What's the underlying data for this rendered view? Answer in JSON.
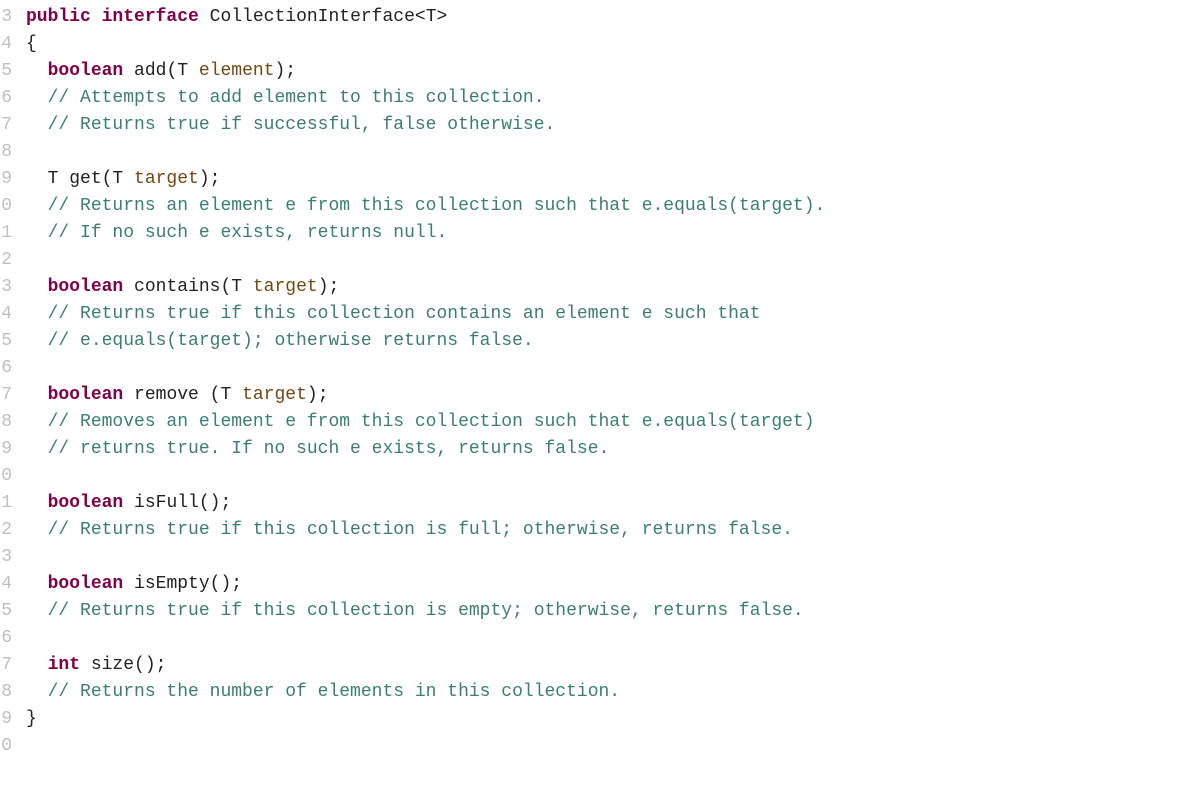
{
  "line_numbers": [
    "3",
    "4",
    "5",
    "6",
    "7",
    "8",
    "9",
    "0",
    "1",
    "2",
    "3",
    "4",
    "5",
    "6",
    "7",
    "8",
    "9",
    "0",
    "1",
    "2",
    "3",
    "4",
    "5",
    "6",
    "7",
    "8",
    "9",
    "0"
  ],
  "colors": {
    "keyword": "#80004a",
    "identifier": "#222222",
    "parameter": "#754710",
    "comment": "#3a7f6f",
    "gutter": "#c0c0c0",
    "background": "#ffffff"
  },
  "code": {
    "lines": [
      {
        "indent": 0,
        "tokens": [
          {
            "t": "kw",
            "s": "public"
          },
          {
            "t": "sp",
            "s": " "
          },
          {
            "t": "kw",
            "s": "interface"
          },
          {
            "t": "sp",
            "s": " "
          },
          {
            "t": "id",
            "s": "CollectionInterface<T>"
          }
        ]
      },
      {
        "indent": 0,
        "tokens": [
          {
            "t": "punc",
            "s": "{"
          }
        ]
      },
      {
        "indent": 1,
        "tokens": [
          {
            "t": "kw",
            "s": "boolean"
          },
          {
            "t": "sp",
            "s": " "
          },
          {
            "t": "id",
            "s": "add(T "
          },
          {
            "t": "param",
            "s": "element"
          },
          {
            "t": "id",
            "s": ");"
          }
        ]
      },
      {
        "indent": 1,
        "tokens": [
          {
            "t": "cm",
            "s": "// Attempts to add element to this collection."
          }
        ]
      },
      {
        "indent": 1,
        "tokens": [
          {
            "t": "cm",
            "s": "// Returns true if successful, false otherwise."
          }
        ]
      },
      {
        "indent": 0,
        "tokens": []
      },
      {
        "indent": 1,
        "tokens": [
          {
            "t": "id",
            "s": "T get(T "
          },
          {
            "t": "param",
            "s": "target"
          },
          {
            "t": "id",
            "s": ");"
          }
        ]
      },
      {
        "indent": 1,
        "tokens": [
          {
            "t": "cm",
            "s": "// Returns an element e from this collection such that e.equals(target)."
          }
        ]
      },
      {
        "indent": 1,
        "tokens": [
          {
            "t": "cm",
            "s": "// If no such e exists, returns null."
          }
        ]
      },
      {
        "indent": 0,
        "tokens": []
      },
      {
        "indent": 1,
        "tokens": [
          {
            "t": "kw",
            "s": "boolean"
          },
          {
            "t": "sp",
            "s": " "
          },
          {
            "t": "id",
            "s": "contains(T "
          },
          {
            "t": "param",
            "s": "target"
          },
          {
            "t": "id",
            "s": ");"
          }
        ]
      },
      {
        "indent": 1,
        "tokens": [
          {
            "t": "cm",
            "s": "// Returns true if this collection contains an element e such that"
          }
        ]
      },
      {
        "indent": 1,
        "tokens": [
          {
            "t": "cm",
            "s": "// e.equals(target); otherwise returns false."
          }
        ]
      },
      {
        "indent": 0,
        "tokens": []
      },
      {
        "indent": 1,
        "tokens": [
          {
            "t": "kw",
            "s": "boolean"
          },
          {
            "t": "sp",
            "s": " "
          },
          {
            "t": "id",
            "s": "remove (T "
          },
          {
            "t": "param",
            "s": "target"
          },
          {
            "t": "id",
            "s": ");"
          }
        ]
      },
      {
        "indent": 1,
        "tokens": [
          {
            "t": "cm",
            "s": "// Removes an element e from this collection such that e.equals(target)"
          }
        ]
      },
      {
        "indent": 1,
        "tokens": [
          {
            "t": "cm",
            "s": "// returns true. If no such e exists, returns false."
          }
        ]
      },
      {
        "indent": 0,
        "tokens": []
      },
      {
        "indent": 1,
        "tokens": [
          {
            "t": "kw",
            "s": "boolean"
          },
          {
            "t": "sp",
            "s": " "
          },
          {
            "t": "id",
            "s": "isFull();"
          }
        ]
      },
      {
        "indent": 1,
        "tokens": [
          {
            "t": "cm",
            "s": "// Returns true if this collection is full; otherwise, returns false."
          }
        ]
      },
      {
        "indent": 0,
        "tokens": []
      },
      {
        "indent": 1,
        "tokens": [
          {
            "t": "kw",
            "s": "boolean"
          },
          {
            "t": "sp",
            "s": " "
          },
          {
            "t": "id",
            "s": "isEmpty();"
          }
        ]
      },
      {
        "indent": 1,
        "tokens": [
          {
            "t": "cm",
            "s": "// Returns true if this collection is empty; otherwise, returns false."
          }
        ]
      },
      {
        "indent": 0,
        "tokens": []
      },
      {
        "indent": 1,
        "tokens": [
          {
            "t": "kw",
            "s": "int"
          },
          {
            "t": "sp",
            "s": " "
          },
          {
            "t": "id",
            "s": "size();"
          }
        ]
      },
      {
        "indent": 1,
        "tokens": [
          {
            "t": "cm",
            "s": "// Returns the number of elements in this collection."
          }
        ]
      },
      {
        "indent": 0,
        "tokens": [
          {
            "t": "punc",
            "s": "}"
          }
        ]
      },
      {
        "indent": 0,
        "tokens": []
      }
    ]
  }
}
